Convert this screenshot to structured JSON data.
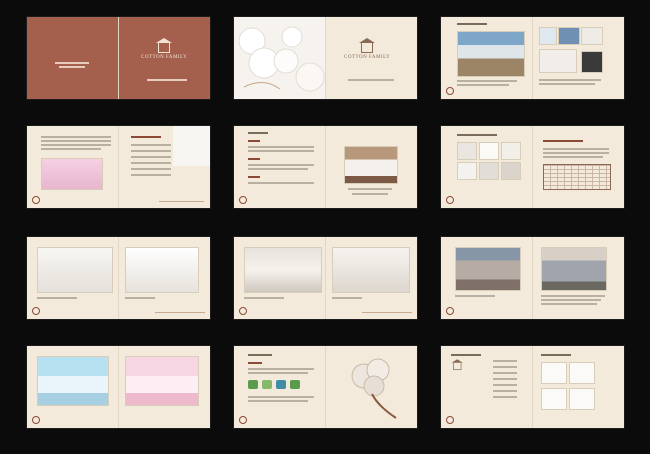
{
  "brand": {
    "name": "COTTON FAMILY",
    "small_name": "COTTON FAMILY"
  },
  "colors": {
    "background": "#0b0b0b",
    "paper": "#f3eadb",
    "cover_brown": "#a4604c",
    "accent": "#8a4a35"
  },
  "icons": [
    "house-logo-icon",
    "cotton-boll-icon",
    "certification-badge-icon"
  ]
}
